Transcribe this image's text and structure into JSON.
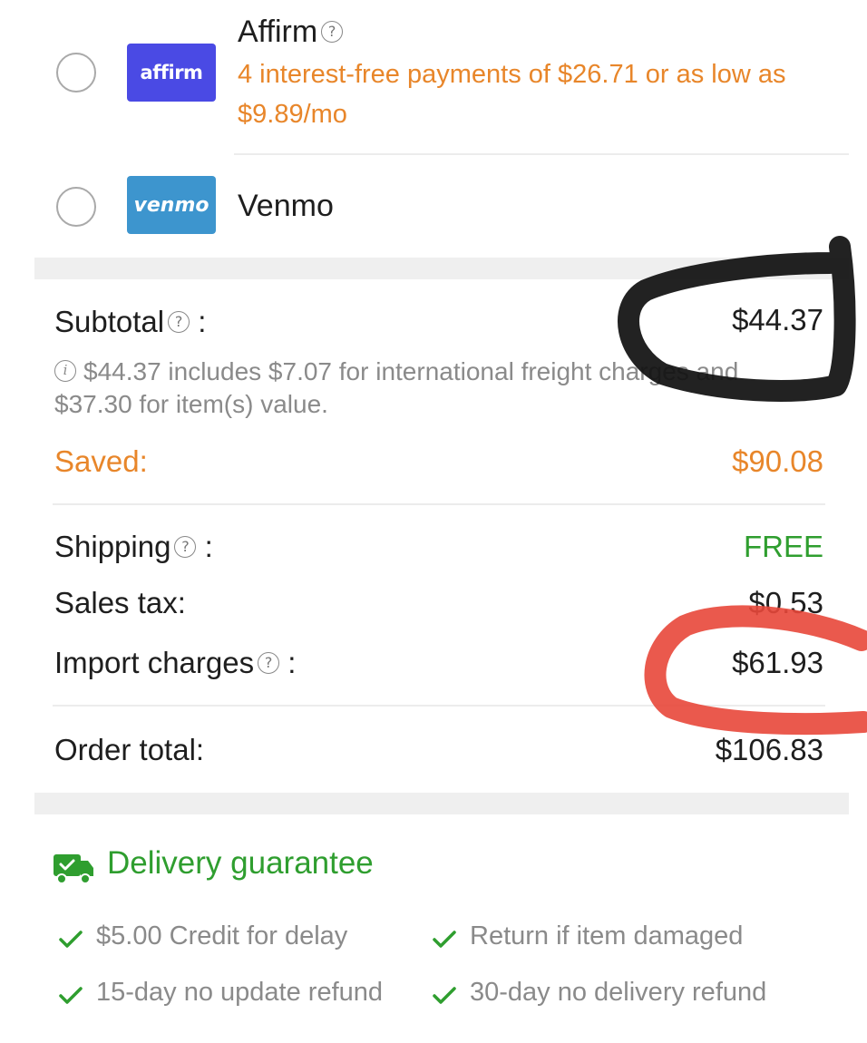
{
  "payment_options": [
    {
      "logo_text": "affirm",
      "name": "Affirm",
      "has_help": true,
      "subtitle": "4 interest-free payments of $26.71 or as low as $9.89/mo",
      "logo_color": "#4a4ae4"
    },
    {
      "logo_text": "venmo",
      "name": "Venmo",
      "has_help": false,
      "logo_color": "#3d95ce"
    }
  ],
  "summary": {
    "subtotal_label": "Subtotal",
    "subtotal_colon": ":",
    "subtotal_value": "$44.37",
    "subtotal_note": "$44.37 includes $7.07 for international freight charges and $37.30 for item(s) value.",
    "saved_label": "Saved:",
    "saved_value": "$90.08",
    "shipping_label": "Shipping",
    "shipping_colon": ":",
    "shipping_value": "FREE",
    "tax_label": "Sales tax:",
    "tax_value": "$0.53",
    "import_label": "Import charges",
    "import_colon": ":",
    "import_value": "$61.93",
    "total_label": "Order total:",
    "total_value": "$106.83"
  },
  "delivery_guarantee": {
    "title": "Delivery guarantee",
    "perks": [
      "$5.00 Credit for delay",
      "Return if item damaged",
      "15-day no update refund",
      "30-day no delivery refund"
    ]
  },
  "icons": {
    "help": "question-circle-icon",
    "info": "info-circle-icon",
    "truck": "delivery-truck-icon",
    "check": "checkmark-icon"
  },
  "colors": {
    "accent_orange": "#e8862a",
    "accent_green": "#2f9e2f",
    "annotation_black": "#111111",
    "annotation_red": "#e8473a"
  }
}
